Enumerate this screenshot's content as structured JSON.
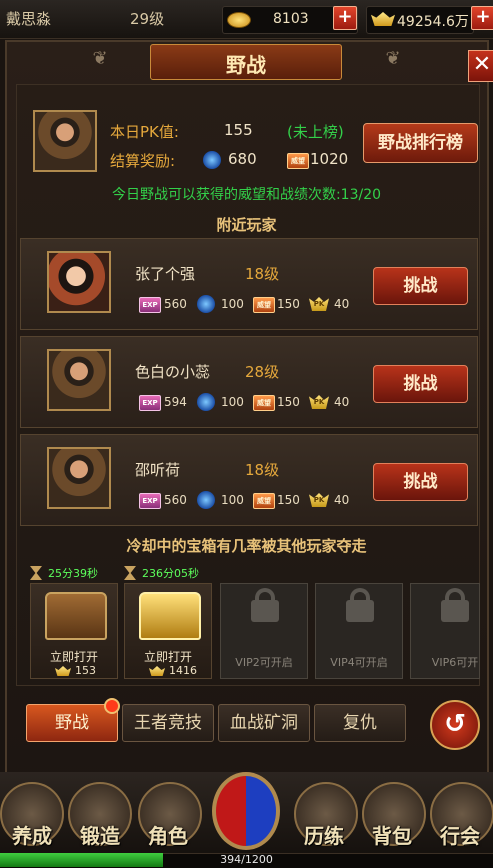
{
  "player": {
    "name": "戴思淼",
    "level": "29级"
  },
  "resources": {
    "coins": "8103",
    "ingots": "49254.6万"
  },
  "panel": {
    "title": "野战"
  },
  "pk": {
    "pk_label": "本日PK值:",
    "pk_value": "155",
    "pk_status": "(未上榜)",
    "reward_label": "结算奖励:",
    "reward_orb": "680",
    "reward_wei": "1020",
    "rank_button": "野战排行榜",
    "notice": "今日野战可以获得的威望和战绩次数:13/20"
  },
  "nearby": {
    "title": "附近玩家",
    "challenge_label": "挑战",
    "players": [
      {
        "name": "张了个强",
        "level": "18级",
        "exp": "560",
        "orb": "100",
        "wei": "150",
        "pk": "40"
      },
      {
        "name": "色白の小蕊",
        "level": "28级",
        "exp": "594",
        "orb": "100",
        "wei": "150",
        "pk": "40"
      },
      {
        "name": "邵听荷",
        "level": "18级",
        "exp": "560",
        "orb": "100",
        "wei": "150",
        "pk": "40"
      }
    ]
  },
  "chests": {
    "warning": "冷却中的宝箱有几率被其他玩家夺走",
    "slots": [
      {
        "timer": "25分39秒",
        "label": "立即打开",
        "cost": "153"
      },
      {
        "timer": "236分05秒",
        "label": "立即打开",
        "cost": "1416"
      }
    ],
    "locked": [
      "VIP2可开启",
      "VIP4可开启",
      "VIP6可开"
    ]
  },
  "tabs": [
    "野战",
    "王者竞技",
    "血战矿洞",
    "复仇"
  ],
  "bottom_nav": [
    "养成",
    "锻造",
    "角色",
    "历练",
    "背包",
    "行会"
  ],
  "xp": {
    "text": "394/1200",
    "fraction": 0.33
  },
  "icons": {
    "exp": "EXP",
    "wei": "威望",
    "pk": "PK"
  },
  "colors": {
    "accent_red": "#b8331a",
    "green": "#33d04a",
    "orange_label": "#e5a83c"
  }
}
